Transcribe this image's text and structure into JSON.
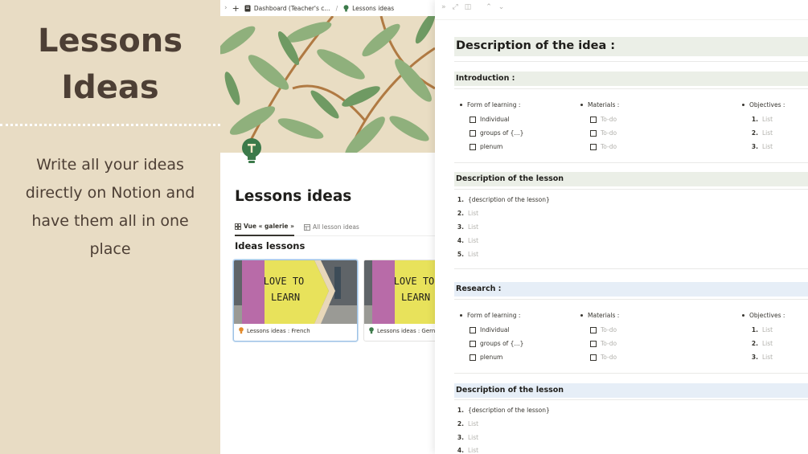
{
  "promo": {
    "title_line1": "Lessons",
    "title_line2": "Ideas",
    "text_line1": "Write all your ideas",
    "text_line2": "directly  on Notion and",
    "text_line3": "have them all in one",
    "text_line4": "place"
  },
  "notion": {
    "breadcrumb": {
      "item1": "Dashboard (Teacher's c...",
      "separator": "/",
      "item2": "Lessons ideas"
    },
    "page_title": "Lessons ideas",
    "view_tabs": [
      {
        "label": "Vue « galerie »"
      },
      {
        "label": "All lesson ideas"
      }
    ],
    "gallery_title": "Ideas lessons",
    "cards": [
      {
        "image_text_line1": "LOVE TO",
        "image_text_line2": "LEARN",
        "label": "Lessons ideas : French"
      },
      {
        "image_text_line1": "LOVE TO",
        "image_text_line2": "LEARN",
        "label": "Lessons ideas : Gern"
      }
    ]
  },
  "panel": {
    "heading": "Description of the idea :",
    "sections": [
      {
        "title": "Introduction :",
        "form_title": "Form of learning :",
        "form_items": [
          "Individual",
          "groups of {...}",
          "plenum"
        ],
        "materials_title": "Materials :",
        "materials_items": [
          "To-do",
          "To-do",
          "To-do"
        ],
        "objectives_title": "Objectives :",
        "objectives_items": [
          {
            "n": "1.",
            "t": "List"
          },
          {
            "n": "2.",
            "t": "List"
          },
          {
            "n": "3.",
            "t": "List"
          }
        ]
      },
      {
        "title": "Research :",
        "form_title": "Form of learning :",
        "form_items": [
          "Individual",
          "groups of {...}",
          "plenum"
        ],
        "materials_title": "Materials :",
        "materials_items": [
          "To-do",
          "To-do",
          "To-do"
        ],
        "objectives_title": "Objectives :",
        "objectives_items": [
          {
            "n": "1.",
            "t": "List"
          },
          {
            "n": "2.",
            "t": "List"
          },
          {
            "n": "3.",
            "t": "List"
          }
        ]
      }
    ],
    "lessons": [
      {
        "title": "Description of the lesson",
        "items": [
          {
            "n": "1.",
            "t": "{description of the lesson}"
          },
          {
            "n": "2.",
            "t": "List"
          },
          {
            "n": "3.",
            "t": "List"
          },
          {
            "n": "4.",
            "t": "List"
          },
          {
            "n": "5.",
            "t": "List"
          }
        ]
      },
      {
        "title": "Description of the lesson",
        "items": [
          {
            "n": "1.",
            "t": "{description of the lesson}"
          },
          {
            "n": "2.",
            "t": "List"
          },
          {
            "n": "3.",
            "t": "List"
          },
          {
            "n": "4.",
            "t": "List"
          }
        ]
      }
    ]
  },
  "colors": {
    "promo_bg": "#e8dcc4",
    "promo_text": "#4d3f35",
    "heading_green": "#ebefe7",
    "heading_blue": "#e6eef7",
    "placeholder": "#b1b0ab"
  }
}
